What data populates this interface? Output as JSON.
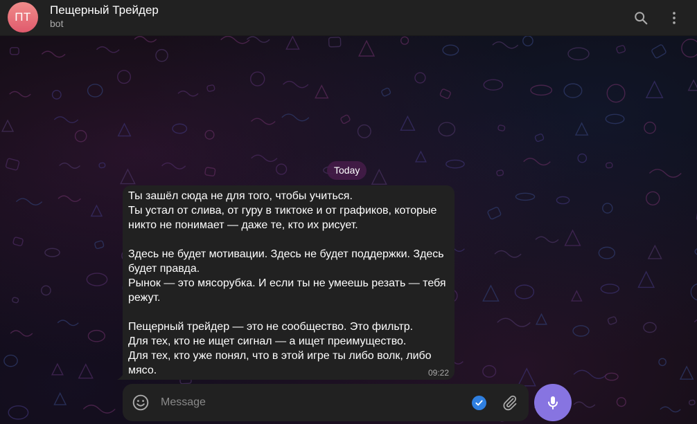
{
  "header": {
    "avatar_initials": "ПТ",
    "title": "Пещерный Трейдер",
    "subtitle": "bot",
    "search_icon": "search-icon",
    "menu_icon": "more-vertical-icon"
  },
  "chat": {
    "date_label": "Today",
    "message": {
      "lines": [
        "Ты зашёл сюда не для того, чтобы учиться.",
        "Ты устал от слива, от гуру в тиктоке и от графиков, которые",
        "никто не понимает — даже те, кто их рисует.",
        "",
        "Здесь не будет мотивации. Здесь не будет поддержки. Здесь",
        "будет правда.",
        "Рынок — это мясорубка. И если ты не умеешь резать — тебя",
        "режут.",
        "",
        "Пещерный трейдер — это не сообщество. Это фильтр.",
        "Для тех, кто не ищет сигнал — а ищет преимущество.",
        "Для тех, кто уже понял, что в этой игре ты либо волк, либо",
        "мясо."
      ],
      "time": "09:22"
    }
  },
  "composer": {
    "placeholder": "Message",
    "value": "",
    "emoji_icon": "emoji-icon",
    "check_icon": "check-icon",
    "attach_icon": "paperclip-icon",
    "mic_icon": "microphone-icon"
  },
  "colors": {
    "accent": "#8774e1",
    "header_bg": "#212121",
    "bubble_bg": "#212121",
    "avatar_gradient_top": "#f08c8a",
    "avatar_gradient_bottom": "#e05a6d",
    "date_pill_bg": "#441c48",
    "check_badge": "#2f7fe0"
  }
}
